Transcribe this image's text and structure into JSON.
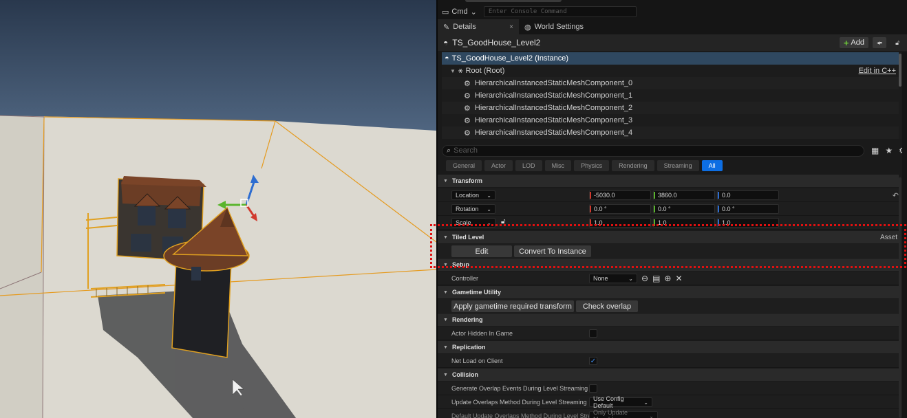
{
  "console": {
    "cmd_label": "Cmd",
    "placeholder": "Enter Console Command"
  },
  "tabs": [
    {
      "label": "Details",
      "close": "×"
    },
    {
      "label": "World Settings"
    }
  ],
  "actor": {
    "name": "TS_GoodHouse_Level2",
    "add_label": "Add"
  },
  "components": {
    "instance": "TS_GoodHouse_Level2 (Instance)",
    "root": "Root (Root)",
    "edit_cpp": "Edit in C++",
    "items": [
      "HierarchicalInstancedStaticMeshComponent_0",
      "HierarchicalInstancedStaticMeshComponent_1",
      "HierarchicalInstancedStaticMeshComponent_2",
      "HierarchicalInstancedStaticMeshComponent_3",
      "HierarchicalInstancedStaticMeshComponent_4"
    ]
  },
  "search": {
    "placeholder": "Search"
  },
  "filters": [
    "General",
    "Actor",
    "LOD",
    "Misc",
    "Physics",
    "Rendering",
    "Streaming",
    "All"
  ],
  "transform": {
    "title": "Transform",
    "location": {
      "label": "Location",
      "x": "-5030.0",
      "y": "3860.0",
      "z": "0.0"
    },
    "rotation": {
      "label": "Rotation",
      "x": "0.0 °",
      "y": "0.0 °",
      "z": "0.0 °"
    },
    "scale": {
      "label": "Scale",
      "x": "1.0",
      "y": "1.0",
      "z": "1.0"
    }
  },
  "tiled_level": {
    "title": "Tiled Level",
    "asset": "Asset",
    "edit_label": "Edit",
    "convert_label": "Convert To Instance"
  },
  "setup": {
    "title": "Setup",
    "controller_label": "Controller",
    "controller_value": "None"
  },
  "gametime": {
    "title": "Gametime Utility",
    "apply_label": "Apply gametime required transform",
    "check_label": "Check overlap"
  },
  "rendering": {
    "title": "Rendering",
    "hidden_label": "Actor Hidden In Game",
    "hidden_checked": false
  },
  "replication": {
    "title": "Replication",
    "netload_label": "Net Load on Client",
    "netload_checked": true
  },
  "collision": {
    "title": "Collision",
    "gen_overlap_label": "Generate Overlap Events During Level Streaming",
    "update_label": "Update Overlaps Method During Level Streaming",
    "update_value": "Use Config Default",
    "default_label": "Default Update Overlaps Method During Level Strea",
    "default_value": "Only Update Movable"
  },
  "colors": {
    "accent": "#0d6ee3",
    "selection": "#2f4860",
    "highlight": "#e01010",
    "gizmo_x": "#d13a2e",
    "gizmo_y": "#5ab52d",
    "gizmo_z": "#2e6ed1"
  }
}
